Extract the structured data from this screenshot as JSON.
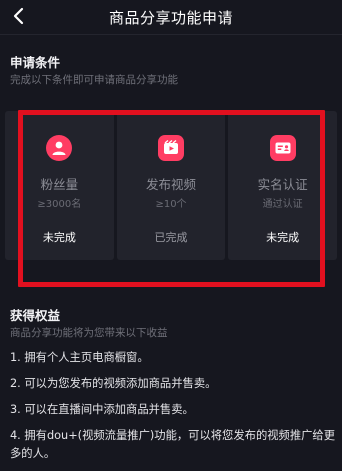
{
  "header": {
    "title": "商品分享功能申请",
    "back_icon": "chevron-left-icon"
  },
  "conditions": {
    "title": "申请条件",
    "subtitle": "完成以下条件即可申请商品分享功能",
    "cards": [
      {
        "name": "粉丝量",
        "requirement": "≥3000名",
        "status": "未完成",
        "icon": "fans-icon"
      },
      {
        "name": "发布视频",
        "requirement": "≥10个",
        "status": "已完成",
        "icon": "video-icon"
      },
      {
        "name": "实名认证",
        "requirement": "通过认证",
        "status": "未完成",
        "icon": "id-card-icon"
      }
    ]
  },
  "benefits": {
    "title": "获得权益",
    "subtitle": "商品分享功能将为您带来以下收益",
    "items": [
      "1. 拥有个人主页电商橱窗。",
      "2. 可以为您发布的视频添加商品并售卖。",
      "3. 可以在直播间中添加商品并售卖。",
      "4. 拥有dou+(视频流量推广)功能，可以将您发布的视频推广给更多的人。"
    ]
  },
  "colors": {
    "accent": "#ff3d63",
    "highlight_box": "#e2101f",
    "background": "#16171f",
    "card": "#22232c"
  }
}
